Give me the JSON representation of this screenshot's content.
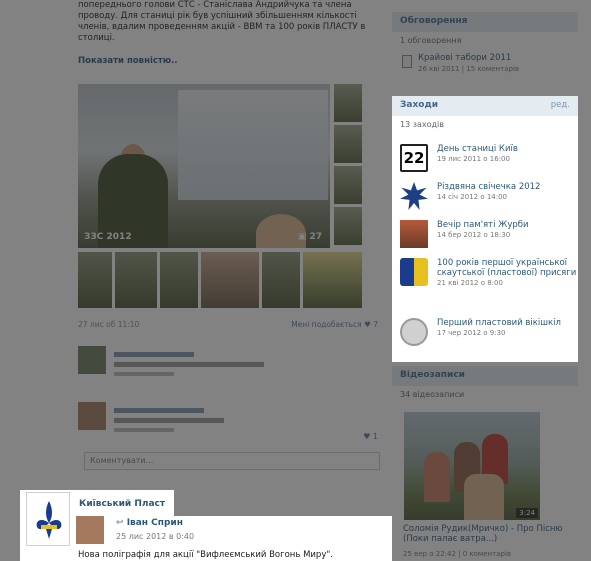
{
  "post": {
    "text": "попереднього голови СТС - Станіслава Андрийчука та члена проводу. Для станиці рік був успішний збільшенням кількості членів, вдалим проведенням акцій - ВВМ та 100 років ПЛАСТУ в столиці.",
    "show_more": "Показати повністю..",
    "album_label": "ЗЗС 2012",
    "photo_count": "27",
    "date": "27 лис об 11:10",
    "likes_label": "Мені подобається",
    "likes_count": "7",
    "comment_likes": "1",
    "comment_placeholder": "Коментувати..."
  },
  "group": {
    "name": "Київський Пласт",
    "author": "Іван Сприн",
    "date": "25 лис 2012 в 0:40",
    "text": "Нова поліграфія для акції \"Вифлеємський Вогонь Миру\"."
  },
  "discussions": {
    "title": "Обговорення",
    "count": "1 обговорення",
    "items": [
      {
        "title": "Крайові табори 2011",
        "meta": "26 кві 2011 | 15 коментарів"
      }
    ]
  },
  "events": {
    "title": "Заходи",
    "edit": "ред.",
    "count": "13 заходів",
    "items": [
      {
        "icon": "calendar-icon",
        "icon_text": "22",
        "title": "День станиці Київ",
        "when": "19 лис 2011 о 16:00"
      },
      {
        "icon": "star-icon",
        "title": "Різдвяна свічечка 2012",
        "when": "14 січ 2012 о 14:00"
      },
      {
        "icon": "photo-icon",
        "title": "Вечір пам'яті Журби",
        "when": "14 бер 2012 о 18:30"
      },
      {
        "icon": "plast-emblem-icon",
        "title": "100 років першої української скаутської (пластової) присяги",
        "when": "21 кві 2012 о 8:00"
      },
      {
        "icon": "wikipedia-icon",
        "title": "Перший пластовий вікішкіл",
        "when": "17 чер 2012 о 9:30"
      }
    ]
  },
  "videos": {
    "title": "Відеозаписи",
    "count": "34 відеозаписи",
    "duration": "3:24",
    "video_title": "Соломія Рудик(Мричко) - Про Пісню (Поки палає ватра...)",
    "video_meta": "25 вер о 22:42 | 0 коментарів"
  }
}
